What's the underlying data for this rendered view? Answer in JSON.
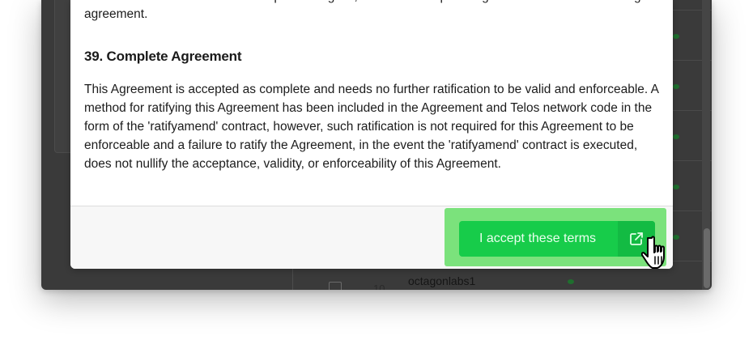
{
  "background": {
    "producer_rank": "10",
    "producer_name": "octagonlabs1"
  },
  "modal": {
    "previous_paragraph": "and delivered shall constitute a duplicate original, but all counterparts together shall constitute a single agreement.",
    "section_heading": "39. Complete Agreement",
    "section_text": "This Agreement is accepted as complete and needs no further ratification to be valid and enforceable. A method for ratifying this Agreement has been included in the Agreement and Telos network code in the form of the 'ratifyamend' contract, however, such ratification is not required for this Agreement to be enforceable and a failure to ratify the Agreement, in the event the 'ratifyamend' contract is executed, does not nullify the acceptance, validity, or enforceability of this Agreement.",
    "accept_button_label": "I accept these terms",
    "accept_icon": "external-link-icon"
  },
  "colors": {
    "accept_button": "#17cc4a",
    "accept_highlight": "#7be27c",
    "overlay_background": "#3a3a3a"
  },
  "cursor_icon": "hand-pointer-icon"
}
